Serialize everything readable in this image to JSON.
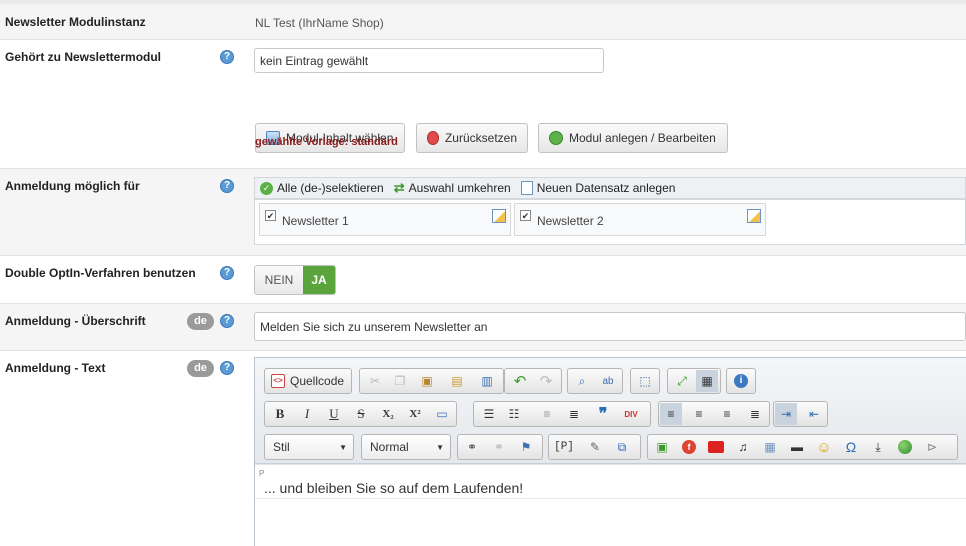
{
  "rows": {
    "instance": {
      "label": "Newsletter Modulinstanz",
      "value": "NL Test (IhrName Shop)"
    },
    "module": {
      "label": "Gehört zu Newslettermodul",
      "input_value": "kein Eintrag gewählt",
      "btn_select": "Modul-Inhalt wählen",
      "btn_reset": "Zurücksetzen",
      "btn_create": "Modul anlegen / Bearbeiten",
      "template_note": "gewählte Vorlage: standard"
    },
    "signup": {
      "label": "Anmeldung möglich für",
      "action_select_all": "Alle (de-)selektieren",
      "action_invert": "Auswahl umkehren",
      "action_new": "Neuen Datensatz anlegen",
      "items": [
        {
          "label": "Newsletter 1",
          "checked": true
        },
        {
          "label": "Newsletter 2",
          "checked": true
        }
      ]
    },
    "optin": {
      "label": "Double OptIn-Verfahren benutzen",
      "no": "NEIN",
      "yes": "JA",
      "selected": "JA"
    },
    "heading": {
      "label": "Anmeldung - Überschrift",
      "lang": "de",
      "value": "Melden Sie sich zu unserem Newsletter an"
    },
    "text": {
      "label": "Anmeldung - Text",
      "lang": "de"
    }
  },
  "help_glyph": "?",
  "editor": {
    "source_label": "Quellcode",
    "style_select": "Stil",
    "format_select": "Normal",
    "path_tag": "P",
    "content": "... und bleiben Sie so auf dem Laufenden!",
    "glyphs": {
      "bold": "B",
      "italic": "I",
      "underline": "U",
      "strike": "S",
      "sub": "X₂",
      "sup": "X²",
      "quote": "❞",
      "omega": "Ω",
      "smiley": "☺",
      "info": "i",
      "tpl": "[P]",
      "div": "DIV"
    }
  },
  "colors": {
    "accent_green": "#5aa43c",
    "template_note": "#8b1a1a",
    "help_blue": "#5b9bd5"
  }
}
